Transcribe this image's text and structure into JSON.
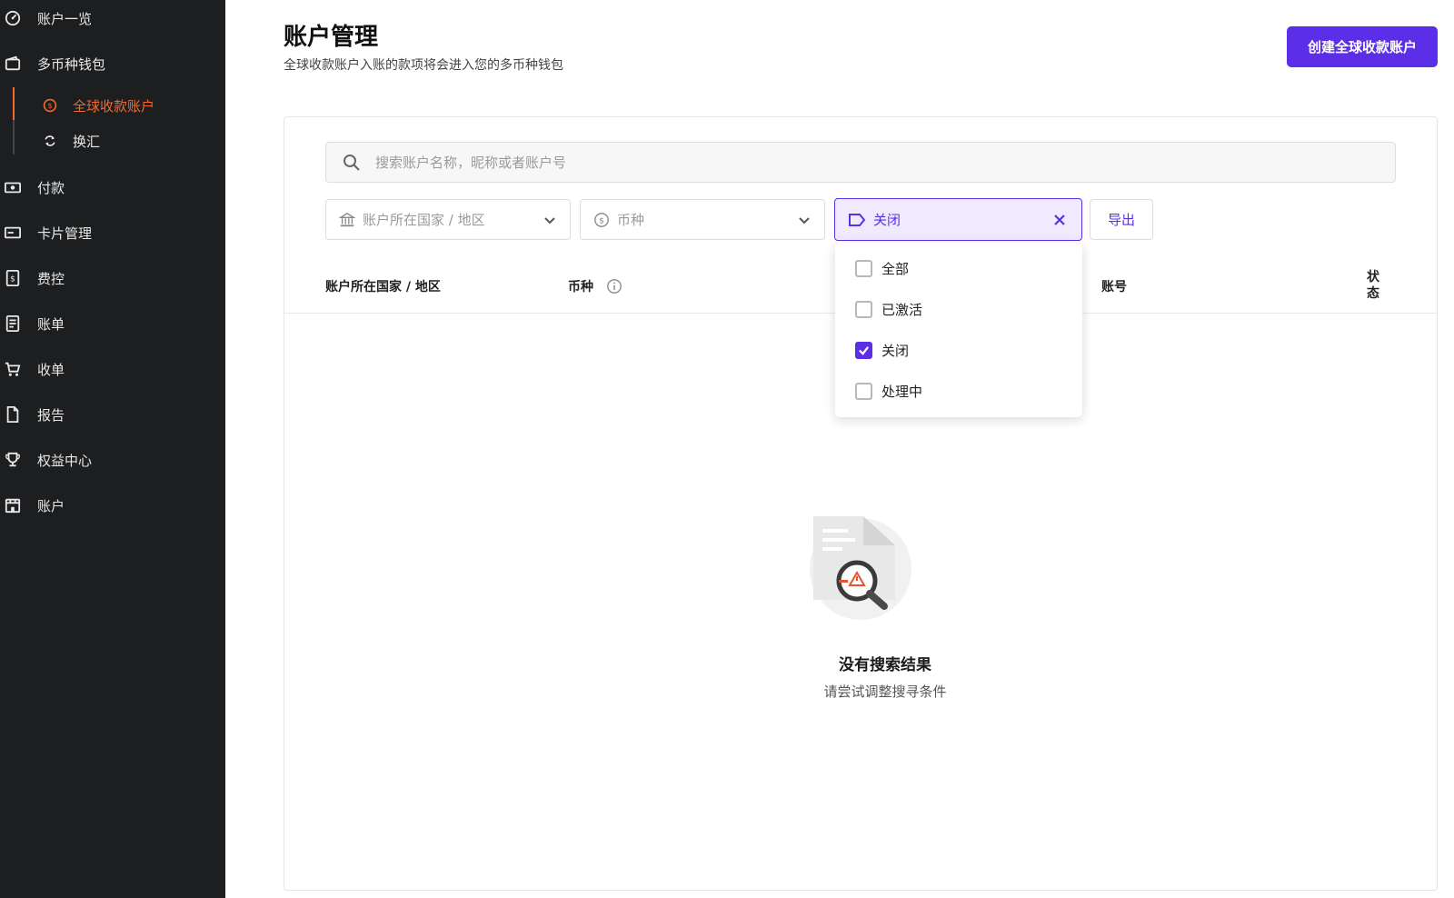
{
  "sidebar": {
    "items": [
      {
        "label": "账户一览",
        "icon": "dashboard-icon"
      },
      {
        "label": "多币种钱包",
        "icon": "wallet-icon"
      },
      {
        "label": "付款",
        "icon": "money-icon"
      },
      {
        "label": "卡片管理",
        "icon": "card-icon"
      },
      {
        "label": "费控",
        "icon": "expense-icon"
      },
      {
        "label": "账单",
        "icon": "bill-icon"
      },
      {
        "label": "收单",
        "icon": "cart-icon"
      },
      {
        "label": "报告",
        "icon": "report-icon"
      },
      {
        "label": "权益中心",
        "icon": "trophy-icon"
      },
      {
        "label": "账户",
        "icon": "store-icon"
      }
    ],
    "sub_items": [
      {
        "label": "全球收款账户",
        "icon": "dollar-circle-icon",
        "active": true
      },
      {
        "label": "换汇",
        "icon": "exchange-icon",
        "active": false
      }
    ],
    "accent_color": "#f26a2e"
  },
  "header": {
    "title": "账户管理",
    "subtitle": "全球收款账户入账的款项将会进入您的多币种钱包",
    "create_button": "创建全球收款账户"
  },
  "search": {
    "placeholder": "搜索账户名称，昵称或者账户号"
  },
  "filters": {
    "country_placeholder": "账户所在国家 / 地区",
    "currency_placeholder": "币种",
    "status_value": "关闭",
    "export_button": "导出"
  },
  "table": {
    "headers": [
      "账户所在国家 / 地区",
      "币种",
      "账号",
      "状态"
    ]
  },
  "status_dropdown": {
    "options": [
      {
        "label": "全部",
        "checked": false
      },
      {
        "label": "已激活",
        "checked": false
      },
      {
        "label": "关闭",
        "checked": true
      },
      {
        "label": "处理中",
        "checked": false
      }
    ]
  },
  "empty_state": {
    "title": "没有搜索结果",
    "description": "请尝试调整搜寻条件"
  },
  "colors": {
    "primary": "#5b2ee8",
    "sidebar_bg": "#1d1e20"
  }
}
